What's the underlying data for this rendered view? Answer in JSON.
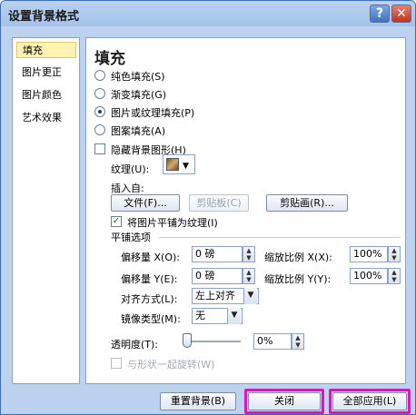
{
  "window": {
    "title": "设置背景格式",
    "help_icon": "?",
    "close_icon": "✕"
  },
  "nav": {
    "items": [
      {
        "label": "填充",
        "active": true
      },
      {
        "label": "图片更正",
        "active": false
      },
      {
        "label": "图片颜色",
        "active": false
      },
      {
        "label": "艺术效果",
        "active": false
      }
    ]
  },
  "fill": {
    "heading": "填充",
    "options": [
      {
        "label": "纯色填充(S)",
        "selected": false
      },
      {
        "label": "渐变填充(G)",
        "selected": false
      },
      {
        "label": "图片或纹理填充(P)",
        "selected": true
      },
      {
        "label": "图案填充(A)",
        "selected": false
      }
    ],
    "hide_background_graphics": "隐藏背景图形(H)",
    "texture_label": "纹理(U):",
    "insert_from": "插入自:",
    "file_button": "文件(F)...",
    "clipboard_button": "剪贴板(C)",
    "clipart_button": "剪贴画(R)...",
    "tile_as_texture": "将图片平铺为纹理(I)",
    "tile_as_texture_checked": true,
    "tiling_options": "平铺选项",
    "offset_x_label": "偏移量 X(O):",
    "offset_x_value": "0 磅",
    "scale_x_label": "缩放比例 X(X):",
    "scale_x_value": "100%",
    "offset_y_label": "偏移量 Y(E):",
    "offset_y_value": "0 磅",
    "scale_y_label": "缩放比例 Y(Y):",
    "scale_y_value": "100%",
    "alignment_label": "对齐方式(L):",
    "alignment_value": "左上对齐",
    "mirror_label": "镜像类型(M):",
    "mirror_value": "无",
    "transparency_label": "透明度(T):",
    "transparency_value": "0%",
    "rotate_with_shape": "与形状一起旋转(W)"
  },
  "footer": {
    "reset_button": "重置背景(B)",
    "close_button": "关闭",
    "apply_all_button": "全部应用(L)"
  },
  "colors": {
    "highlight": "#e014b8",
    "title_bar": "#a5c2ea"
  }
}
